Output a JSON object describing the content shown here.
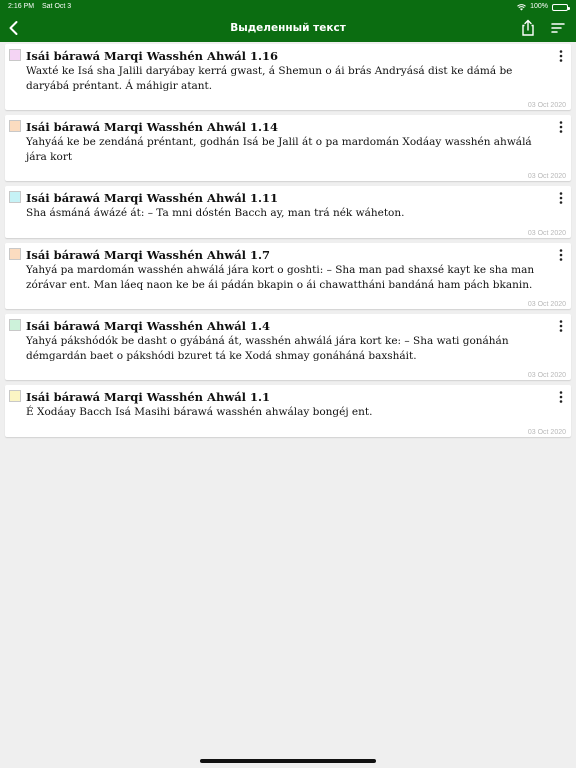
{
  "status": {
    "time": "2:16 PM",
    "date": "Sat Oct 3",
    "battery": "100%"
  },
  "nav": {
    "title": "Выделенный текст",
    "back_icon": "chevron-left-icon",
    "share_icon": "share-icon",
    "sort_icon": "sort-icon"
  },
  "colors": {
    "bar": "#0b6d11",
    "more_icon": "more-vertical-icon"
  },
  "items": [
    {
      "title": "Isái bárawá Marqi Wasshén Ahwál 1.16",
      "text": "Waxté ke Isá sha Jalili daryábay kerrá gwast, á Shemun o ái brás Andryásá dist ke dámá be daryábá préntant. Á máhigir atant.",
      "date": "03 Oct 2020",
      "color": "#f4d4f4"
    },
    {
      "title": "Isái bárawá Marqi Wasshén Ahwál 1.14",
      "text": "Yahyáá ke be zendáná préntant, godhán Isá be Jalil át o pa mardomán Xodáay wasshén ahwálá jára kort",
      "date": "03 Oct 2020",
      "color": "#fbdcc0"
    },
    {
      "title": "Isái bárawá Marqi Wasshén Ahwál 1.11",
      "text": "Sha ásmáná áwázé át: – Ta mni dóstén Bacch ay, man trá nék wáheton.",
      "date": "03 Oct 2020",
      "color": "#c6f2f6"
    },
    {
      "title": "Isái bárawá Marqi Wasshén Ahwál 1.7",
      "text": "Yahyá pa mardomán wasshén ahwálá jára kort o goshti: – Sha man pad shaxsé kayt ke sha man zórávar ent. Man láeq naon ke be ái pádán bkapin o ái chawattháni bandáná ham pách bkanin.",
      "date": "03 Oct 2020",
      "color": "#fbdcc0"
    },
    {
      "title": "Isái bárawá Marqi Wasshén Ahwál 1.4",
      "text": "Yahyá pákshódók be dasht o gyábáná át, wasshén ahwálá jára kort ke: – Sha wati gonáhán démgardán baet o pákshódi bzuret tá ke Xodá shmay gonáháná baxsháit.",
      "date": "03 Oct 2020",
      "color": "#cdf2da"
    },
    {
      "title": "Isái bárawá Marqi Wasshén Ahwál 1.1",
      "text": "É Xodáay Bacch Isá Masihi bárawá wasshén ahwálay bongéj ent.",
      "date": "03 Oct 2020",
      "color": "#fbf5c4"
    }
  ]
}
